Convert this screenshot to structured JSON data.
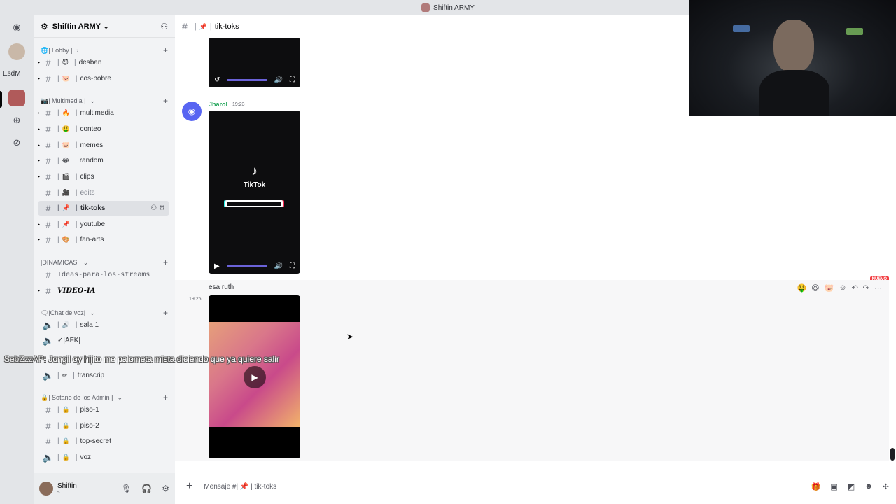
{
  "window": {
    "title": "Shiftin ARMY"
  },
  "rail": {
    "user_label": "EsdM"
  },
  "server": {
    "name": "Shiftin ARMY"
  },
  "categories": [
    {
      "label": "| Lobby |",
      "emoji": "🌐"
    },
    {
      "label": "| Multimedia |",
      "emoji": "📷"
    },
    {
      "label": "|DINAMICAS|",
      "emoji": ""
    },
    {
      "label": "|Chat de voz|",
      "emoji": "🗨"
    },
    {
      "label": "| Sotano de los Admin |",
      "emoji": "🔒"
    }
  ],
  "channels": [
    {
      "name": "desban",
      "emoji": "😈"
    },
    {
      "name": "cos-pobre",
      "emoji": "🐷"
    },
    {
      "name": "multimedia",
      "emoji": "🔥"
    },
    {
      "name": "conteo",
      "emoji": "🤑"
    },
    {
      "name": "memes",
      "emoji": "🐷"
    },
    {
      "name": "random",
      "emoji": "😂"
    },
    {
      "name": "clips",
      "emoji": "🎬"
    },
    {
      "name": "edits",
      "emoji": "🎥"
    },
    {
      "name": "tik-toks",
      "emoji": "📌"
    },
    {
      "name": "youtube",
      "emoji": "📌"
    },
    {
      "name": "fan-arts",
      "emoji": "🎨"
    },
    {
      "name": "Ideas-para-los-streams",
      "emoji": ""
    },
    {
      "name": "VIDEO-IA",
      "emoji": ""
    },
    {
      "name": "sala 1",
      "emoji": "🔊"
    },
    {
      "name": "✓|AFK|",
      "emoji": ""
    },
    {
      "name": "transcrip",
      "emoji": "✏"
    },
    {
      "name": "piso-1",
      "emoji": "🔒"
    },
    {
      "name": "piso-2",
      "emoji": "🔒"
    },
    {
      "name": "top-secret",
      "emoji": "🔒"
    },
    {
      "name": "voz",
      "emoji": "🔒"
    }
  ],
  "user": {
    "name": "Shiftin",
    "status": "s..."
  },
  "header": {
    "channel": "tik-toks",
    "emoji": "📌"
  },
  "messages": {
    "author": "Jharol",
    "time1": "19:23",
    "tiktok_text": "TikTok",
    "new_label": "NUEVO",
    "text": "esa ruth",
    "time2": "19:26"
  },
  "composer": {
    "placeholder": "Mensaje #| 📌 | tik-toks"
  },
  "overlay": {
    "user": "SebZzzAP",
    "text": ": Jongil oy hijito me palometa mista diciendo que ya quiere salir"
  },
  "colors": {
    "accent": "#5865f2",
    "new_divider": "#f23f43",
    "author": "#23a55a"
  }
}
